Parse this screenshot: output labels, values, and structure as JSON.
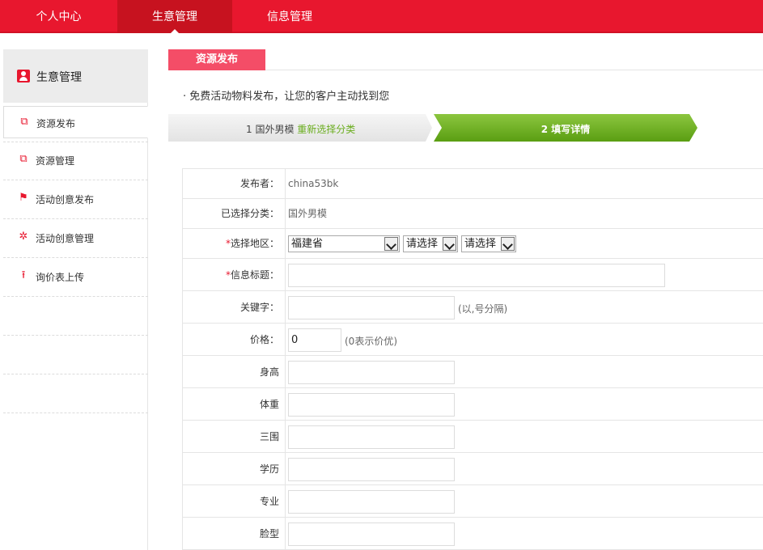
{
  "topnav": {
    "items": [
      {
        "label": "个人中心",
        "active": false
      },
      {
        "label": "生意管理",
        "active": true
      },
      {
        "label": "信息管理",
        "active": false
      }
    ]
  },
  "sidebar": {
    "title": "生意管理",
    "items": [
      {
        "label": "资源发布",
        "icon": "copy-icon",
        "active": true
      },
      {
        "label": "资源管理",
        "icon": "copy-icon",
        "active": false
      },
      {
        "label": "活动创意发布",
        "icon": "flag-icon",
        "active": false
      },
      {
        "label": "活动创意管理",
        "icon": "atom-icon",
        "active": false
      },
      {
        "label": "询价表上传",
        "icon": "upload-icon",
        "active": false
      }
    ]
  },
  "main": {
    "tab_title": "资源发布",
    "notice": "· 免费活动物料发布，让您的客户主动找到您",
    "steps": {
      "step1_text": "1 国外男模",
      "step1_link": "重新选择分类",
      "step2_text": "2 填写详情"
    },
    "form": {
      "publisher_label": "发布者：",
      "publisher_value": "china53bk",
      "category_label": "已选择分类：",
      "category_value": "国外男模",
      "region_label": "选择地区：",
      "region_province": "福建省",
      "region_city": "请选择",
      "region_district": "请选择",
      "title_label": "信息标题：",
      "title_value": "",
      "keywords_label": "关键字：",
      "keywords_value": "",
      "keywords_hint": "(以,号分隔)",
      "price_label": "价格：",
      "price_value": "0",
      "price_hint": "(0表示价优)",
      "height_label": "身高",
      "weight_label": "体重",
      "measurements_label": "三围",
      "education_label": "学历",
      "major_label": "专业",
      "face_label": "脸型"
    }
  },
  "colors": {
    "brand_red": "#e8172e",
    "tab_pink": "#f44d67",
    "step_green": "#6aad1e"
  }
}
